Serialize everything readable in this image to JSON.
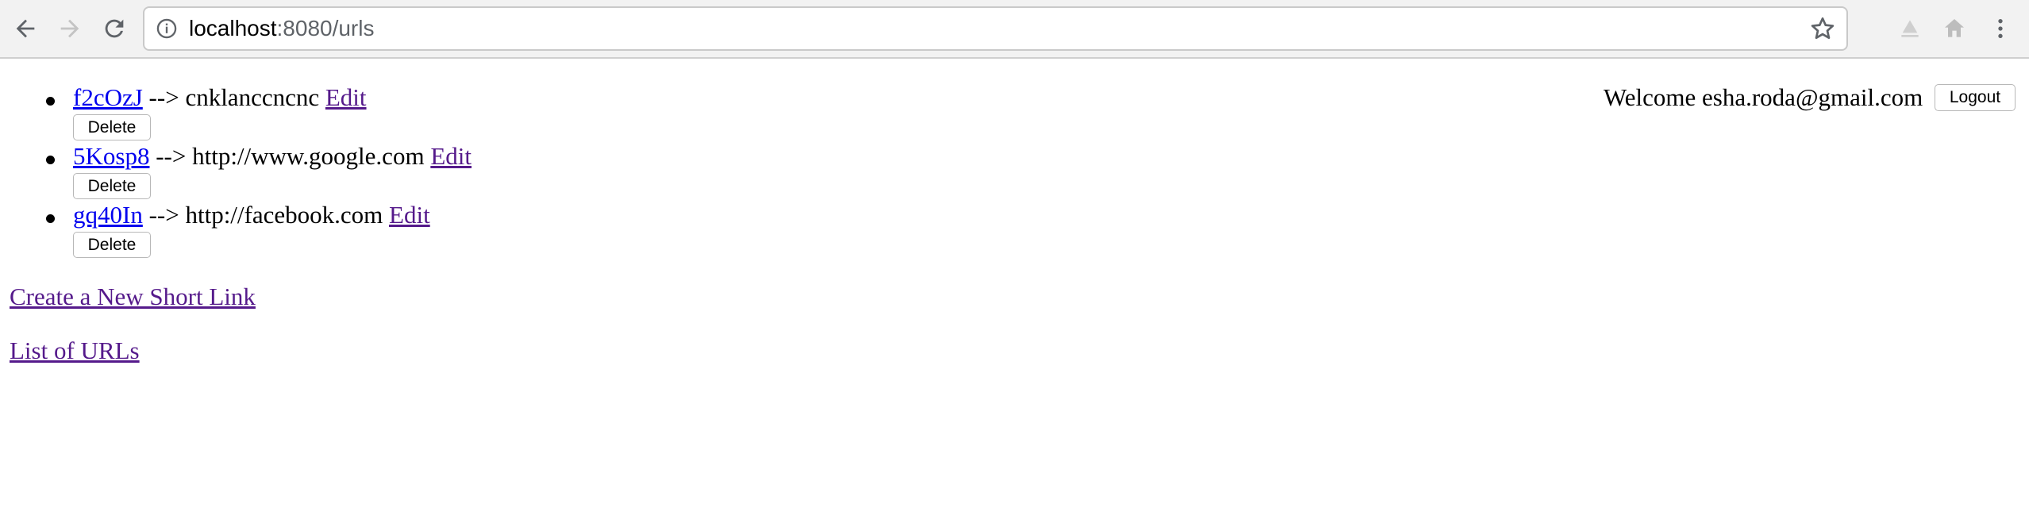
{
  "browser": {
    "url_host": "localhost",
    "url_path": ":8080/urls",
    "icons": [
      "back-arrow-icon",
      "forward-arrow-icon",
      "reload-icon",
      "info-icon",
      "bookmark-star-icon",
      "extension-icon",
      "home-icon",
      "menu-dots-icon"
    ]
  },
  "urls": [
    {
      "short": "f2cOzJ",
      "arrow": "-->",
      "long": "cnklanccncnc",
      "edit": "Edit",
      "delete": "Delete"
    },
    {
      "short": "5Kosp8",
      "arrow": "-->",
      "long": "http://www.google.com",
      "edit": "Edit",
      "delete": "Delete"
    },
    {
      "short": "gq40In",
      "arrow": "-->",
      "long": "http://facebook.com",
      "edit": "Edit",
      "delete": "Delete"
    }
  ],
  "header": {
    "welcome": "Welcome esha.roda@gmail.com",
    "logout": "Logout"
  },
  "links": {
    "create": "Create a New Short Link",
    "list": "List of URLs"
  },
  "colors": {
    "unvisited_link": "#0000ee",
    "visited_link": "#551a8b",
    "toolbar_bg": "#f2f2f2"
  }
}
